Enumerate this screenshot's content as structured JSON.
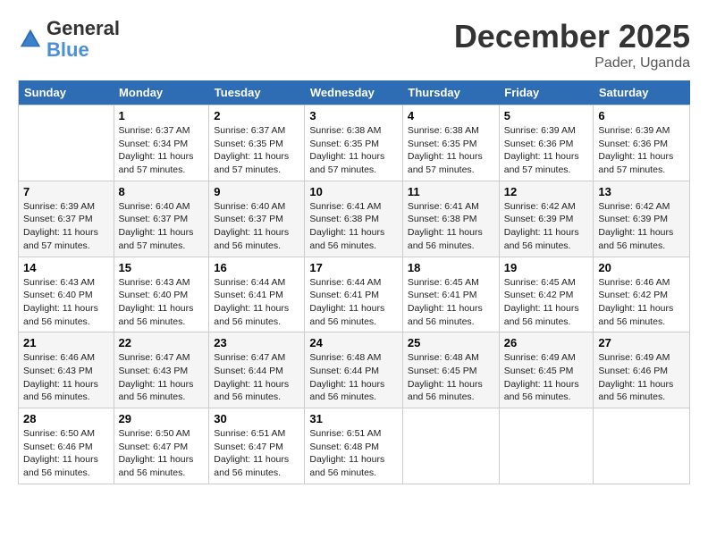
{
  "header": {
    "logo_general": "General",
    "logo_blue": "Blue",
    "month_title": "December 2025",
    "subtitle": "Pader, Uganda"
  },
  "weekdays": [
    "Sunday",
    "Monday",
    "Tuesday",
    "Wednesday",
    "Thursday",
    "Friday",
    "Saturday"
  ],
  "weeks": [
    [
      {
        "day": "",
        "info": ""
      },
      {
        "day": "1",
        "info": "Sunrise: 6:37 AM\nSunset: 6:34 PM\nDaylight: 11 hours and 57 minutes."
      },
      {
        "day": "2",
        "info": "Sunrise: 6:37 AM\nSunset: 6:35 PM\nDaylight: 11 hours and 57 minutes."
      },
      {
        "day": "3",
        "info": "Sunrise: 6:38 AM\nSunset: 6:35 PM\nDaylight: 11 hours and 57 minutes."
      },
      {
        "day": "4",
        "info": "Sunrise: 6:38 AM\nSunset: 6:35 PM\nDaylight: 11 hours and 57 minutes."
      },
      {
        "day": "5",
        "info": "Sunrise: 6:39 AM\nSunset: 6:36 PM\nDaylight: 11 hours and 57 minutes."
      },
      {
        "day": "6",
        "info": "Sunrise: 6:39 AM\nSunset: 6:36 PM\nDaylight: 11 hours and 57 minutes."
      }
    ],
    [
      {
        "day": "7",
        "info": "Sunrise: 6:39 AM\nSunset: 6:37 PM\nDaylight: 11 hours and 57 minutes."
      },
      {
        "day": "8",
        "info": "Sunrise: 6:40 AM\nSunset: 6:37 PM\nDaylight: 11 hours and 57 minutes."
      },
      {
        "day": "9",
        "info": "Sunrise: 6:40 AM\nSunset: 6:37 PM\nDaylight: 11 hours and 56 minutes."
      },
      {
        "day": "10",
        "info": "Sunrise: 6:41 AM\nSunset: 6:38 PM\nDaylight: 11 hours and 56 minutes."
      },
      {
        "day": "11",
        "info": "Sunrise: 6:41 AM\nSunset: 6:38 PM\nDaylight: 11 hours and 56 minutes."
      },
      {
        "day": "12",
        "info": "Sunrise: 6:42 AM\nSunset: 6:39 PM\nDaylight: 11 hours and 56 minutes."
      },
      {
        "day": "13",
        "info": "Sunrise: 6:42 AM\nSunset: 6:39 PM\nDaylight: 11 hours and 56 minutes."
      }
    ],
    [
      {
        "day": "14",
        "info": "Sunrise: 6:43 AM\nSunset: 6:40 PM\nDaylight: 11 hours and 56 minutes."
      },
      {
        "day": "15",
        "info": "Sunrise: 6:43 AM\nSunset: 6:40 PM\nDaylight: 11 hours and 56 minutes."
      },
      {
        "day": "16",
        "info": "Sunrise: 6:44 AM\nSunset: 6:41 PM\nDaylight: 11 hours and 56 minutes."
      },
      {
        "day": "17",
        "info": "Sunrise: 6:44 AM\nSunset: 6:41 PM\nDaylight: 11 hours and 56 minutes."
      },
      {
        "day": "18",
        "info": "Sunrise: 6:45 AM\nSunset: 6:41 PM\nDaylight: 11 hours and 56 minutes."
      },
      {
        "day": "19",
        "info": "Sunrise: 6:45 AM\nSunset: 6:42 PM\nDaylight: 11 hours and 56 minutes."
      },
      {
        "day": "20",
        "info": "Sunrise: 6:46 AM\nSunset: 6:42 PM\nDaylight: 11 hours and 56 minutes."
      }
    ],
    [
      {
        "day": "21",
        "info": "Sunrise: 6:46 AM\nSunset: 6:43 PM\nDaylight: 11 hours and 56 minutes."
      },
      {
        "day": "22",
        "info": "Sunrise: 6:47 AM\nSunset: 6:43 PM\nDaylight: 11 hours and 56 minutes."
      },
      {
        "day": "23",
        "info": "Sunrise: 6:47 AM\nSunset: 6:44 PM\nDaylight: 11 hours and 56 minutes."
      },
      {
        "day": "24",
        "info": "Sunrise: 6:48 AM\nSunset: 6:44 PM\nDaylight: 11 hours and 56 minutes."
      },
      {
        "day": "25",
        "info": "Sunrise: 6:48 AM\nSunset: 6:45 PM\nDaylight: 11 hours and 56 minutes."
      },
      {
        "day": "26",
        "info": "Sunrise: 6:49 AM\nSunset: 6:45 PM\nDaylight: 11 hours and 56 minutes."
      },
      {
        "day": "27",
        "info": "Sunrise: 6:49 AM\nSunset: 6:46 PM\nDaylight: 11 hours and 56 minutes."
      }
    ],
    [
      {
        "day": "28",
        "info": "Sunrise: 6:50 AM\nSunset: 6:46 PM\nDaylight: 11 hours and 56 minutes."
      },
      {
        "day": "29",
        "info": "Sunrise: 6:50 AM\nSunset: 6:47 PM\nDaylight: 11 hours and 56 minutes."
      },
      {
        "day": "30",
        "info": "Sunrise: 6:51 AM\nSunset: 6:47 PM\nDaylight: 11 hours and 56 minutes."
      },
      {
        "day": "31",
        "info": "Sunrise: 6:51 AM\nSunset: 6:48 PM\nDaylight: 11 hours and 56 minutes."
      },
      {
        "day": "",
        "info": ""
      },
      {
        "day": "",
        "info": ""
      },
      {
        "day": "",
        "info": ""
      }
    ]
  ]
}
